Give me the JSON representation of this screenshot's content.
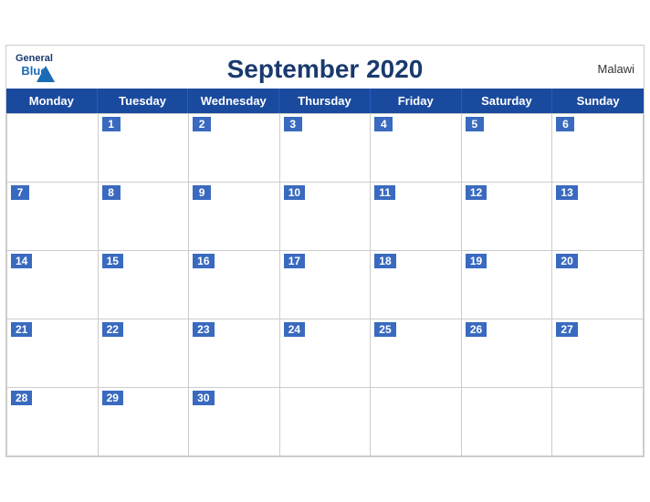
{
  "header": {
    "title": "September 2020",
    "brand_general": "General",
    "brand_blue": "Blue",
    "country": "Malawi"
  },
  "days": {
    "headers": [
      "Monday",
      "Tuesday",
      "Wednesday",
      "Thursday",
      "Friday",
      "Saturday",
      "Sunday"
    ]
  },
  "weeks": [
    [
      null,
      1,
      2,
      3,
      4,
      5,
      6
    ],
    [
      7,
      8,
      9,
      10,
      11,
      12,
      13
    ],
    [
      14,
      15,
      16,
      17,
      18,
      19,
      20
    ],
    [
      21,
      22,
      23,
      24,
      25,
      26,
      27
    ],
    [
      28,
      29,
      30,
      null,
      null,
      null,
      null
    ]
  ]
}
